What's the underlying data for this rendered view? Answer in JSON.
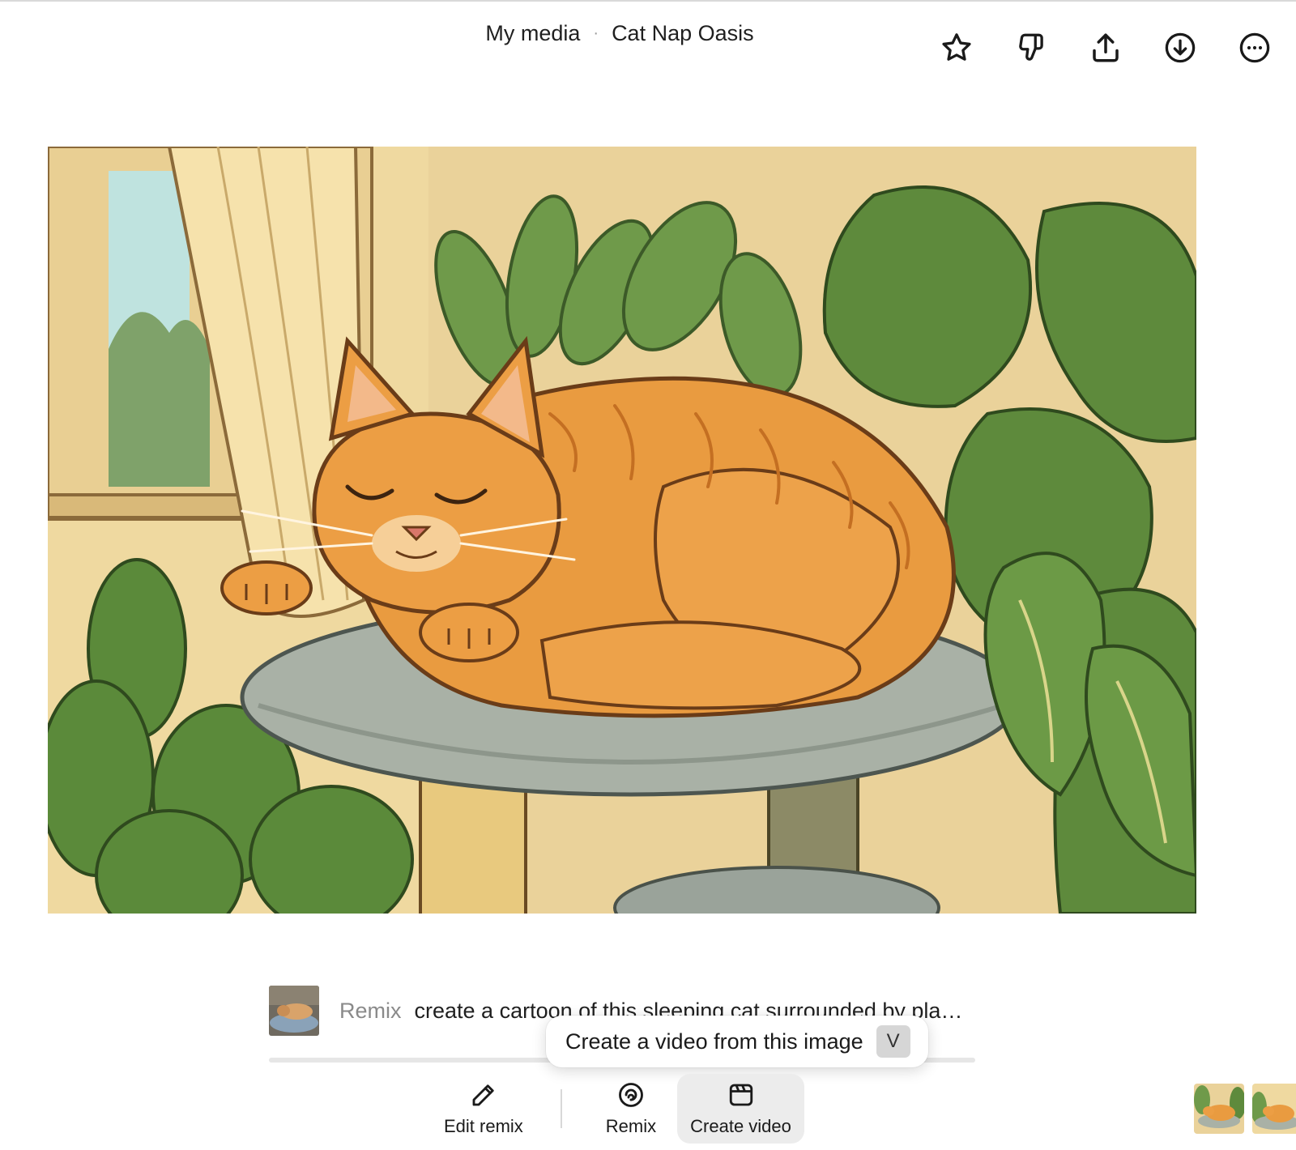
{
  "header": {
    "breadcrumb_root": "My media",
    "breadcrumb_separator": "·",
    "title": "Cat Nap Oasis",
    "actions": [
      {
        "icon": "star-icon",
        "label": "Favorite"
      },
      {
        "icon": "thumbs-down-icon",
        "label": "Dislike"
      },
      {
        "icon": "share-icon",
        "label": "Share"
      },
      {
        "icon": "download-icon",
        "label": "Download"
      },
      {
        "icon": "more-icon",
        "label": "More"
      }
    ]
  },
  "remix": {
    "tag": "Remix",
    "prompt": "create a cartoon of this sleeping cat surrounded by plants"
  },
  "tooltip": {
    "text": "Create a video from this image",
    "shortcut": "V"
  },
  "toolbar": {
    "edit_remix_label": "Edit remix",
    "remix_label": "Remix",
    "create_video_label": "Create video"
  },
  "colors": {
    "accent_active_bg": "#ececec",
    "cat_orange": "#e59a3f",
    "plant_green": "#5e8f3e"
  }
}
